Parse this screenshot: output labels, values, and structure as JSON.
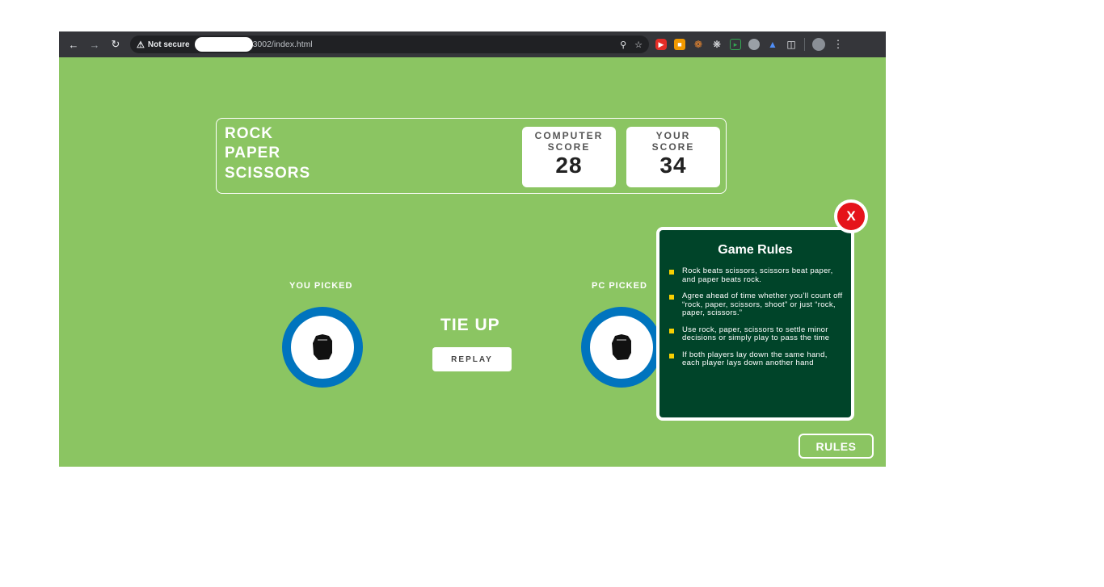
{
  "browser": {
    "security_label": "Not secure",
    "url": "3002/index.html"
  },
  "game": {
    "title_lines": [
      "ROCK",
      "PAPER",
      "SCISSORS"
    ],
    "computer_score": {
      "label_line1": "COMPUTER",
      "label_line2": "SCORE",
      "value": "28"
    },
    "your_score": {
      "label_line1": "YOUR",
      "label_line2": "SCORE",
      "value": "34"
    },
    "you_picked_label": "YOU PICKED",
    "pc_picked_label": "PC PICKED",
    "you_pick": "rock",
    "pc_pick": "rock",
    "result": "TIE UP",
    "replay_label": "REPLAY",
    "rules_button_label": "RULES"
  },
  "rules": {
    "title": "Game Rules",
    "close_label": "X",
    "items": [
      "Rock beats scissors, scissors beat paper, and paper beats rock.",
      "Agree ahead of time whether you’ll count off “rock, paper, scissors, shoot” or just “rock, paper, scissors.”",
      "Use rock, paper, scissors to settle minor decisions or simply play to pass the time",
      "If both players lay down the same hand, each player lays down another hand"
    ]
  },
  "colors": {
    "background": "#8bc562",
    "pick_ring": "#0074be",
    "rules_panel": "#004429",
    "close_button": "#e5131a",
    "bullet": "#f7d002"
  }
}
